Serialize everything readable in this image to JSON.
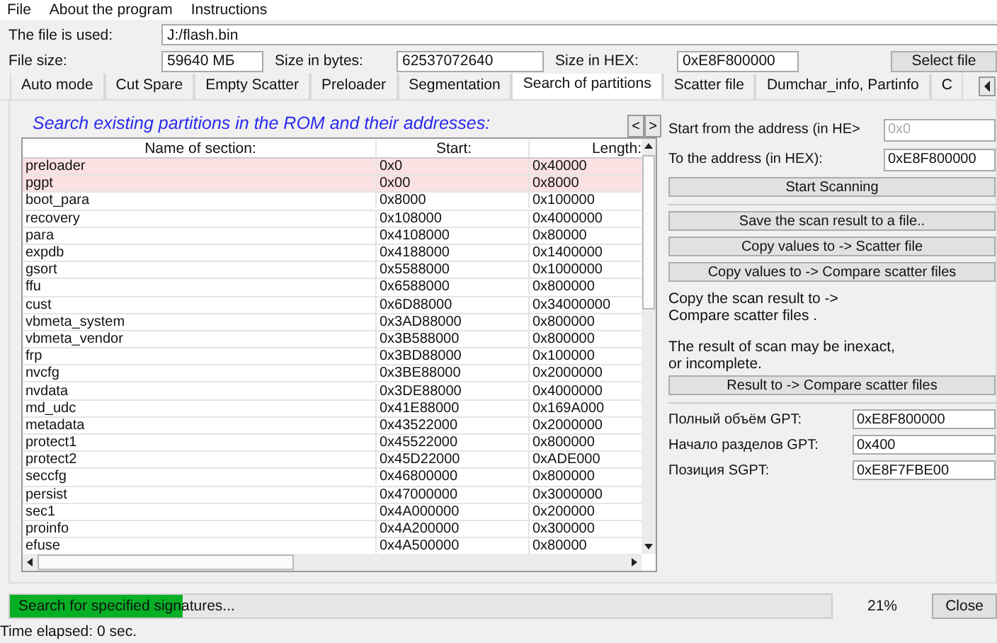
{
  "menu": [
    "File",
    "About the program",
    "Instructions"
  ],
  "file_row": {
    "label": "The file is used:",
    "value": "J:/flash.bin"
  },
  "size_row": [
    {
      "label": "File size:",
      "value": "59640 МБ"
    },
    {
      "label": "Size in bytes:",
      "value": "62537072640"
    },
    {
      "label": "Size in HEX:",
      "value": "0xE8F800000"
    }
  ],
  "select_file_button": "Select file",
  "tabs": [
    {
      "label": "Auto mode",
      "selected": false
    },
    {
      "label": "Cut Spare",
      "selected": false
    },
    {
      "label": "Empty Scatter",
      "selected": false
    },
    {
      "label": "Preloader",
      "selected": false
    },
    {
      "label": "Segmentation",
      "selected": false
    },
    {
      "label": "Search of partitions",
      "selected": true
    },
    {
      "label": "Scatter file",
      "selected": false
    },
    {
      "label": "Dumchar_info, Partinfo",
      "selected": false
    },
    {
      "label": "C",
      "selected": false
    }
  ],
  "heading": "Search existing partitions in the ROM and their addresses:",
  "nav_buttons": [
    "<",
    ">"
  ],
  "table": {
    "columns": [
      "Name of section:",
      "Start:",
      "Length:"
    ],
    "rows": [
      {
        "cells": [
          "preloader",
          "0x0",
          "0x40000"
        ],
        "highlighted": true
      },
      {
        "cells": [
          "pgpt",
          "0x00",
          "0x8000"
        ],
        "highlighted": true
      },
      {
        "cells": [
          "boot_para",
          "0x8000",
          "0x100000"
        ],
        "highlighted": false
      },
      {
        "cells": [
          "recovery",
          "0x108000",
          "0x4000000"
        ],
        "highlighted": false
      },
      {
        "cells": [
          "para",
          "0x4108000",
          "0x80000"
        ],
        "highlighted": false
      },
      {
        "cells": [
          "expdb",
          "0x4188000",
          "0x1400000"
        ],
        "highlighted": false
      },
      {
        "cells": [
          "gsort",
          "0x5588000",
          "0x1000000"
        ],
        "highlighted": false
      },
      {
        "cells": [
          "ffu",
          "0x6588000",
          "0x800000"
        ],
        "highlighted": false
      },
      {
        "cells": [
          "cust",
          "0x6D88000",
          "0x34000000"
        ],
        "highlighted": false
      },
      {
        "cells": [
          "vbmeta_system",
          "0x3AD88000",
          "0x800000"
        ],
        "highlighted": false
      },
      {
        "cells": [
          "vbmeta_vendor",
          "0x3B588000",
          "0x800000"
        ],
        "highlighted": false
      },
      {
        "cells": [
          "frp",
          "0x3BD88000",
          "0x100000"
        ],
        "highlighted": false
      },
      {
        "cells": [
          "nvcfg",
          "0x3BE88000",
          "0x2000000"
        ],
        "highlighted": false
      },
      {
        "cells": [
          "nvdata",
          "0x3DE88000",
          "0x4000000"
        ],
        "highlighted": false
      },
      {
        "cells": [
          "md_udc",
          "0x41E88000",
          "0x169A000"
        ],
        "highlighted": false
      },
      {
        "cells": [
          "metadata",
          "0x43522000",
          "0x2000000"
        ],
        "highlighted": false
      },
      {
        "cells": [
          "protect1",
          "0x45522000",
          "0x800000"
        ],
        "highlighted": false
      },
      {
        "cells": [
          "protect2",
          "0x45D22000",
          "0xADE000"
        ],
        "highlighted": false
      },
      {
        "cells": [
          "seccfg",
          "0x46800000",
          "0x800000"
        ],
        "highlighted": false
      },
      {
        "cells": [
          "persist",
          "0x47000000",
          "0x3000000"
        ],
        "highlighted": false
      },
      {
        "cells": [
          "sec1",
          "0x4A000000",
          "0x200000"
        ],
        "highlighted": false
      },
      {
        "cells": [
          "proinfo",
          "0x4A200000",
          "0x300000"
        ],
        "highlighted": false
      },
      {
        "cells": [
          "efuse",
          "0x4A500000",
          "0x80000"
        ],
        "highlighted": false
      }
    ]
  },
  "range": [
    {
      "label": "Start from the address (in HE>",
      "value": "0x0",
      "disabled": true
    },
    {
      "label": "To the address (in HEX):",
      "value": "0xE8F800000",
      "disabled": false
    }
  ],
  "start_button": "Start Scanning",
  "action_buttons": [
    "Save the scan result to a file..",
    "Copy values to -> Scatter file",
    "Copy values to -> Compare scatter files"
  ],
  "note_1": "Copy the scan result to -> Compare scatter files .",
  "note_2": "The result of scan may be inexact, or incomplete.",
  "result_button": "Result to -> Compare scatter files",
  "gpt_fields": [
    {
      "label": "Полный объём GPT:",
      "value": "0xE8F800000"
    },
    {
      "label": "Начало разделов GPT:",
      "value": "0x400"
    },
    {
      "label": "Позиция SGPT:",
      "value": "0xE8F7FBE00"
    }
  ],
  "progress": {
    "text": "Search for specified signatures...",
    "level": 0.21,
    "reading": "21%"
  },
  "close_button": "Close",
  "status": "Time elapsed: 0  sec."
}
